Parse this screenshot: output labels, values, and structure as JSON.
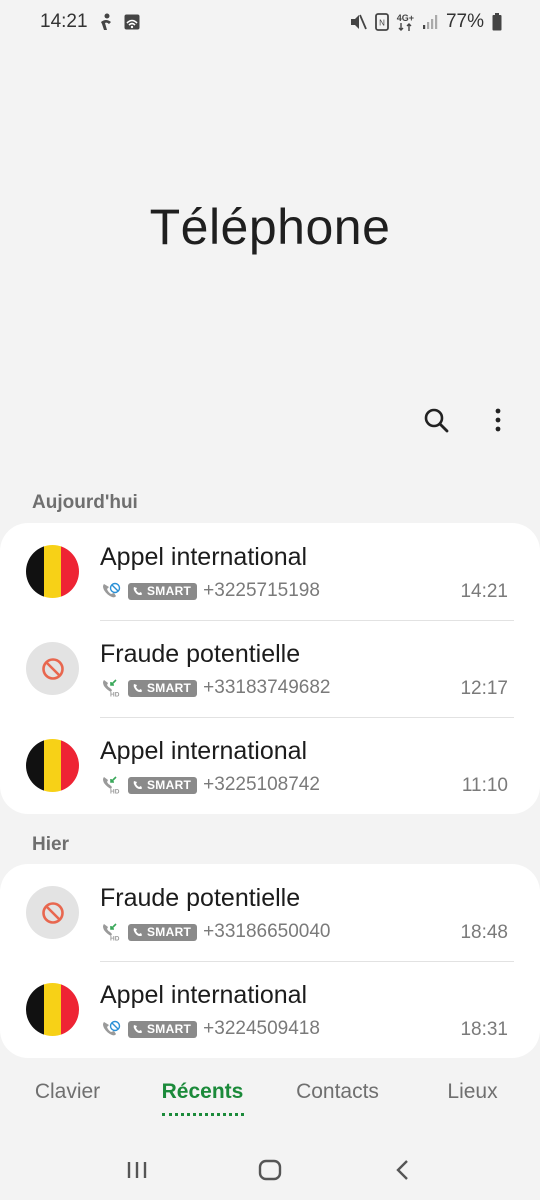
{
  "status_bar": {
    "time": "14:21",
    "battery_percent": "77%",
    "network_label": "4G+",
    "icons": [
      "accessibility-icon",
      "screen-cast-icon",
      "mute-icon",
      "nfc-icon",
      "network-4g-icon",
      "signal-icon",
      "battery-icon"
    ]
  },
  "app": {
    "title": "Téléphone"
  },
  "toolbar": {
    "search_icon": "search-icon",
    "more_icon": "more-options-icon"
  },
  "sections": {
    "today": {
      "label": "Aujourd'hui",
      "calls": [
        {
          "name": "Appel international",
          "avatar": "flag-belgium",
          "call_type": "wifi-call-icon",
          "badge": "SMART",
          "number": "+3225715198",
          "time": "14:21"
        },
        {
          "name": "Fraude potentielle",
          "avatar": "block-icon",
          "call_type": "hd-incoming-call-icon",
          "badge": "SMART",
          "number": "+33183749682",
          "time": "12:17"
        },
        {
          "name": "Appel international",
          "avatar": "flag-belgium",
          "call_type": "hd-incoming-call-icon",
          "badge": "SMART",
          "number": "+3225108742",
          "time": "11:10"
        }
      ]
    },
    "yesterday": {
      "label": "Hier",
      "calls": [
        {
          "name": "Fraude potentielle",
          "avatar": "block-icon",
          "call_type": "hd-incoming-call-icon",
          "badge": "SMART",
          "number": "+33186650040",
          "time": "18:48"
        },
        {
          "name": "Appel international",
          "avatar": "flag-belgium",
          "call_type": "wifi-call-icon",
          "badge": "SMART",
          "number": "+3224509418",
          "time": "18:31"
        }
      ]
    }
  },
  "tabs": [
    {
      "label": "Clavier",
      "active": false
    },
    {
      "label": "Récents",
      "active": true
    },
    {
      "label": "Contacts",
      "active": false
    },
    {
      "label": "Lieux",
      "active": false
    }
  ],
  "colors": {
    "accent": "#1b8a3a",
    "background": "#f3f3f3",
    "card": "#ffffff",
    "flag_black": "#111111",
    "flag_yellow": "#f7d117",
    "flag_red": "#ee2434"
  }
}
